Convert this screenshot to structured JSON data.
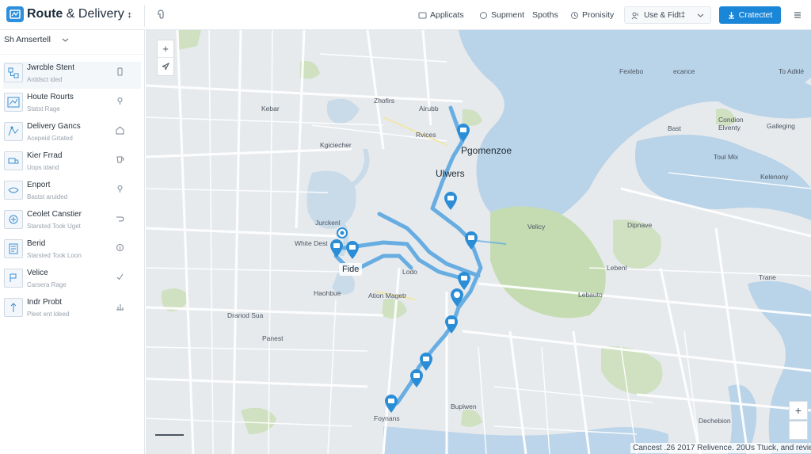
{
  "app": {
    "title": "Route",
    "title_amp": "& Delivery",
    "title_suffix": "‡"
  },
  "topnav": [
    {
      "label": "Applicats",
      "icon": "box-icon"
    },
    {
      "label": "Supment",
      "icon": "circle-icon"
    },
    {
      "label": "Spoths",
      "icon": ""
    },
    {
      "label": "Pronisity",
      "icon": "clock-icon"
    }
  ],
  "user_dropdown": {
    "label": "Use & Fidt‡"
  },
  "cta": {
    "label": "Cratectet"
  },
  "sidebar": {
    "select_label": "Sh Amsertell",
    "items": [
      {
        "title": "Jwrcble Stent",
        "sub": "Arddsct ided"
      },
      {
        "title": "Houte Rourts",
        "sub": "Statst Rage"
      },
      {
        "title": "Delivery Gancs",
        "sub": "Acepeid Grtated"
      },
      {
        "title": "Kier Frrad",
        "sub": "Uops idand"
      },
      {
        "title": "Enport",
        "sub": "Bastst aruided"
      },
      {
        "title": "Ceolet Canstier",
        "sub": "Starsted Took Uget"
      },
      {
        "title": "Berid",
        "sub": "Starsted Took Loon"
      },
      {
        "title": "Velice",
        "sub": "Carsera Rage"
      },
      {
        "title": "Indr Probt",
        "sub": "Pleet ent ldeed"
      }
    ]
  },
  "map": {
    "labels": {
      "kebar": "Kebar",
      "zhofirs": "Zhofirs",
      "airubb": "Airubb",
      "rvices": "Rvices",
      "pgomenzoe": "Pgomenzoe",
      "ulwers": "Ulwers",
      "kgiciecher": "Kgiciecher",
      "jurckenl": "Jurckenl",
      "white_dest": "White Dest",
      "fide": "Fide",
      "lodo": "Lodo",
      "haohbue": "Haohbue",
      "ation_magetr": "Ation Magetr",
      "dranod_sua": "Dranod Sua",
      "panest": "Panest",
      "foynans": "Foynans",
      "bupiwen": "Bupiwen",
      "velicy": "Velicy",
      "dipnave": "Dipnave",
      "lebenl": "Lebenl",
      "lebauto": "Lebauto",
      "trane": "Trane",
      "dechebion": "Dechebion",
      "bast": "Bast",
      "condion_elventy": "Condion\nElventy",
      "galleging": "Galleging",
      "toul_mix": "Toul Mix",
      "kelenony": "Kelenony",
      "to_adkle": "To Adklé",
      "ecance": "ecance",
      "fexlebo": "Fexlebo"
    },
    "attribution": "Cancest .26 2017 Relivence. 20Us Ttuck, and reviee",
    "route_color": "#5aa7e0",
    "pin_color": "#2b8dd6",
    "water_color": "#b9d3e8",
    "park_color": "#c5dcb3"
  }
}
